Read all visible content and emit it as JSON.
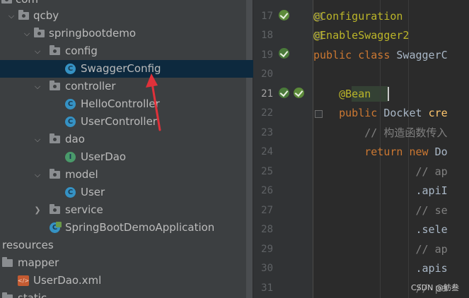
{
  "project_tree": {
    "items": [
      {
        "label": "com"
      },
      {
        "label": "qcby"
      },
      {
        "label": "springbootdemo"
      },
      {
        "label": "config"
      },
      {
        "label": "SwaggerConfig"
      },
      {
        "label": "controller"
      },
      {
        "label": "HelloController"
      },
      {
        "label": "UserController"
      },
      {
        "label": "dao"
      },
      {
        "label": "UserDao"
      },
      {
        "label": "model"
      },
      {
        "label": "User"
      },
      {
        "label": "service"
      },
      {
        "label": "SpringBootDemoApplication"
      },
      {
        "label": "resources"
      },
      {
        "label": "mapper"
      },
      {
        "label": "UserDao.xml"
      },
      {
        "label": "static"
      }
    ]
  },
  "gutter": {
    "line_numbers": [
      "17",
      "18",
      "19",
      "20",
      "21",
      "22",
      "23",
      "24",
      "25",
      "26",
      "27",
      "28",
      "29",
      "30",
      "31"
    ]
  },
  "editor": {
    "lines": [
      {
        "tokens": [
          {
            "t": "@Configuration"
          }
        ]
      },
      {
        "tokens": [
          {
            "t": "@EnableSwagger2"
          }
        ]
      },
      {
        "tokens": [
          {
            "t": "public class "
          },
          {
            "t": "SwaggerC"
          }
        ]
      },
      {
        "tokens": []
      },
      {
        "tokens": [
          {
            "t": "    "
          },
          {
            "t": "@Bean"
          }
        ]
      },
      {
        "tokens": [
          {
            "t": "    "
          },
          {
            "t": "public "
          },
          {
            "t": "Docket "
          },
          {
            "t": "cre"
          }
        ]
      },
      {
        "tokens": [
          {
            "t": "        "
          },
          {
            "t": "// 构造函数传入"
          }
        ]
      },
      {
        "tokens": [
          {
            "t": "        "
          },
          {
            "t": "return new "
          },
          {
            "t": "Do"
          }
        ]
      },
      {
        "tokens": [
          {
            "t": "                "
          },
          {
            "t": "// ap"
          }
        ]
      },
      {
        "tokens": [
          {
            "t": "                "
          },
          {
            "t": ".apiI"
          }
        ]
      },
      {
        "tokens": [
          {
            "t": "                "
          },
          {
            "t": "// se"
          }
        ]
      },
      {
        "tokens": [
          {
            "t": "                "
          },
          {
            "t": ".sele"
          }
        ]
      },
      {
        "tokens": [
          {
            "t": "                "
          },
          {
            "t": "// ap"
          }
        ]
      },
      {
        "tokens": [
          {
            "t": "                "
          },
          {
            "t": ".apis"
          }
        ]
      },
      {
        "tokens": [
          {
            "t": "                "
          },
          {
            "t": "// pa"
          }
        ]
      }
    ]
  },
  "watermark": "CSDN @鲂叁",
  "colors": {
    "tree_bg": "#3c3f41",
    "editor_bg": "#2b2b2b",
    "selection": "#0d293e",
    "annotation": "#bbb529",
    "keyword": "#cc7832",
    "comment": "#808080",
    "arrow": "#e0313a"
  }
}
